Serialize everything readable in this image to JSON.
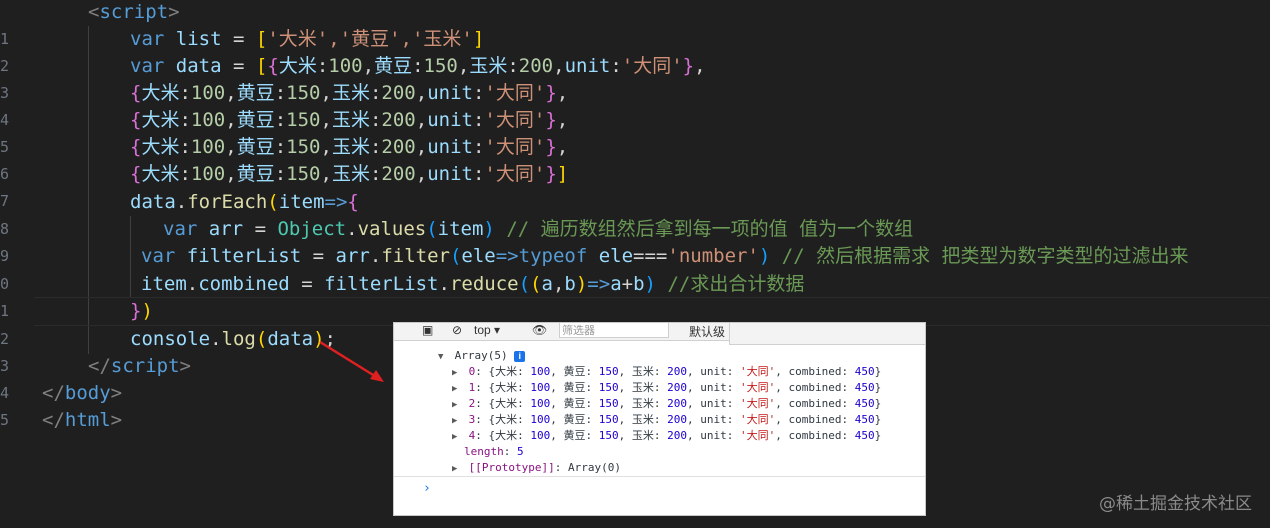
{
  "editor": {
    "line_numbers": [
      "",
      "1",
      "2",
      "3",
      "4",
      "5",
      "6",
      "7",
      "8",
      "9",
      "0",
      "1",
      "2",
      "3",
      "4",
      "5"
    ],
    "comments": {
      "values": "// 遍历数组然后拿到每一项的值 值为一个数组",
      "filter": "// 然后根据需求 把类型为数字类型的过滤出来",
      "reduce": "//求出合计数据"
    },
    "strings": {
      "list": "'大米','黄豆','玉米'",
      "unit": "'大同'",
      "number": "'number'"
    }
  },
  "devtools": {
    "toolbar": {
      "context": "top ▾",
      "filter_placeholder": "筛选器",
      "levels": "默认级"
    },
    "array_label": "Array(5)",
    "info_badge": "i",
    "rows": [
      {
        "index": "0",
        "text_a": "{大米: ",
        "v1": "100",
        "text_b": ", 黄豆: ",
        "v2": "150",
        "text_c": ", 玉米: ",
        "v3": "200",
        "text_d": ", unit: ",
        "unit": "'大同'",
        "text_e": ", combined: ",
        "combined": "450",
        "end": "}"
      },
      {
        "index": "1",
        "text_a": "{大米: ",
        "v1": "100",
        "text_b": ", 黄豆: ",
        "v2": "150",
        "text_c": ", 玉米: ",
        "v3": "200",
        "text_d": ", unit: ",
        "unit": "'大同'",
        "text_e": ", combined: ",
        "combined": "450",
        "end": "}"
      },
      {
        "index": "2",
        "text_a": "{大米: ",
        "v1": "100",
        "text_b": ", 黄豆: ",
        "v2": "150",
        "text_c": ", 玉米: ",
        "v3": "200",
        "text_d": ", unit: ",
        "unit": "'大同'",
        "text_e": ", combined: ",
        "combined": "450",
        "end": "}"
      },
      {
        "index": "3",
        "text_a": "{大米: ",
        "v1": "100",
        "text_b": ", 黄豆: ",
        "v2": "150",
        "text_c": ", 玉米: ",
        "v3": "200",
        "text_d": ", unit: ",
        "unit": "'大同'",
        "text_e": ", combined: ",
        "combined": "450",
        "end": "}"
      },
      {
        "index": "4",
        "text_a": "{大米: ",
        "v1": "100",
        "text_b": ", 黄豆: ",
        "v2": "150",
        "text_c": ", 玉米: ",
        "v3": "200",
        "text_d": ", unit: ",
        "unit": "'大同'",
        "text_e": ", combined: ",
        "combined": "450",
        "end": "}"
      }
    ],
    "length_label": "length",
    "length_value": "5",
    "prototype_label": "[[Prototype]]",
    "prototype_value": ": Array(0)",
    "prompt": "›"
  },
  "watermark": "@稀土掘金技术社区",
  "colors": {
    "background": "#1f1f1f",
    "keyword": "#569cd6",
    "string": "#ce9178",
    "comment": "#6a9955",
    "number": "#b5cea8",
    "arrow": "#e02020"
  }
}
